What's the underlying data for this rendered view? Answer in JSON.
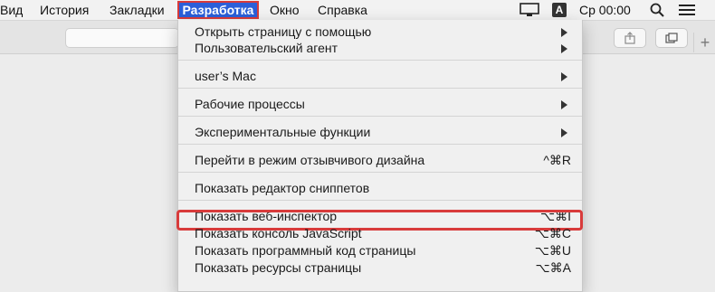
{
  "menubar": {
    "items": [
      {
        "label": "Вид"
      },
      {
        "label": "История"
      },
      {
        "label": "Закладки"
      },
      {
        "label": "Разработка"
      },
      {
        "label": "Окно"
      },
      {
        "label": "Справка"
      }
    ],
    "input_indicator": "A",
    "clock": "Ср 00:00",
    "icons": [
      "display-icon",
      "search-icon",
      "list-icon"
    ]
  },
  "toolbar": {
    "new_tab_label": "+"
  },
  "develop_menu": {
    "items": [
      {
        "label": "Открыть страницу с помощью",
        "submenu": true
      },
      {
        "label": "Пользовательский агент",
        "submenu": true
      },
      {
        "label": "user’s Mac",
        "submenu": true
      },
      {
        "label": "Рабочие процессы",
        "submenu": true
      },
      {
        "label": "Экспериментальные функции",
        "submenu": true
      },
      {
        "label": "Перейти в режим отзывчивого дизайна",
        "shortcut": "^⌘R"
      },
      {
        "label": "Показать редактор сниппетов"
      },
      {
        "label": "Показать веб-инспектор",
        "shortcut": "⌥⌘I",
        "highlighted": true
      },
      {
        "label": "Показать консоль JavaScript",
        "shortcut": "⌥⌘C"
      },
      {
        "label": "Показать программный код страницы",
        "shortcut": "⌥⌘U"
      },
      {
        "label": "Показать ресурсы страницы",
        "shortcut": "⌥⌘A"
      }
    ]
  },
  "colors": {
    "active_menu_bg": "#2b5fd9",
    "highlight_border": "#d83b3b"
  }
}
